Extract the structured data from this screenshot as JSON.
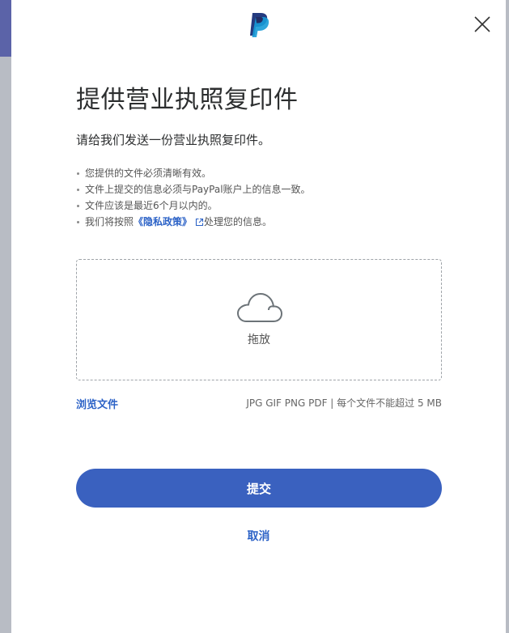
{
  "header": {
    "logo": "paypal-logo",
    "close_icon": "close-icon"
  },
  "content": {
    "title": "提供营业执照复印件",
    "subtitle": "请给我们发送一份营业执照复印件。",
    "bullets": [
      "您提供的文件必须清晰有效。",
      "文件上提交的信息必须与PayPal账户上的信息一致。",
      "文件应该是最近6个月以内的。"
    ],
    "policy": {
      "prefix": "我们将按照",
      "link": "《隐私政策》",
      "suffix": "处理您的信息。"
    }
  },
  "upload": {
    "drop_label": "拖放",
    "browse_label": "浏览文件",
    "formats": "JPG GIF PNG PDF | 每个文件不能超过 5 MB"
  },
  "actions": {
    "submit_label": "提交",
    "cancel_label": "取消"
  },
  "colors": {
    "primary": "#3a61bf",
    "link": "#2d63c7"
  }
}
